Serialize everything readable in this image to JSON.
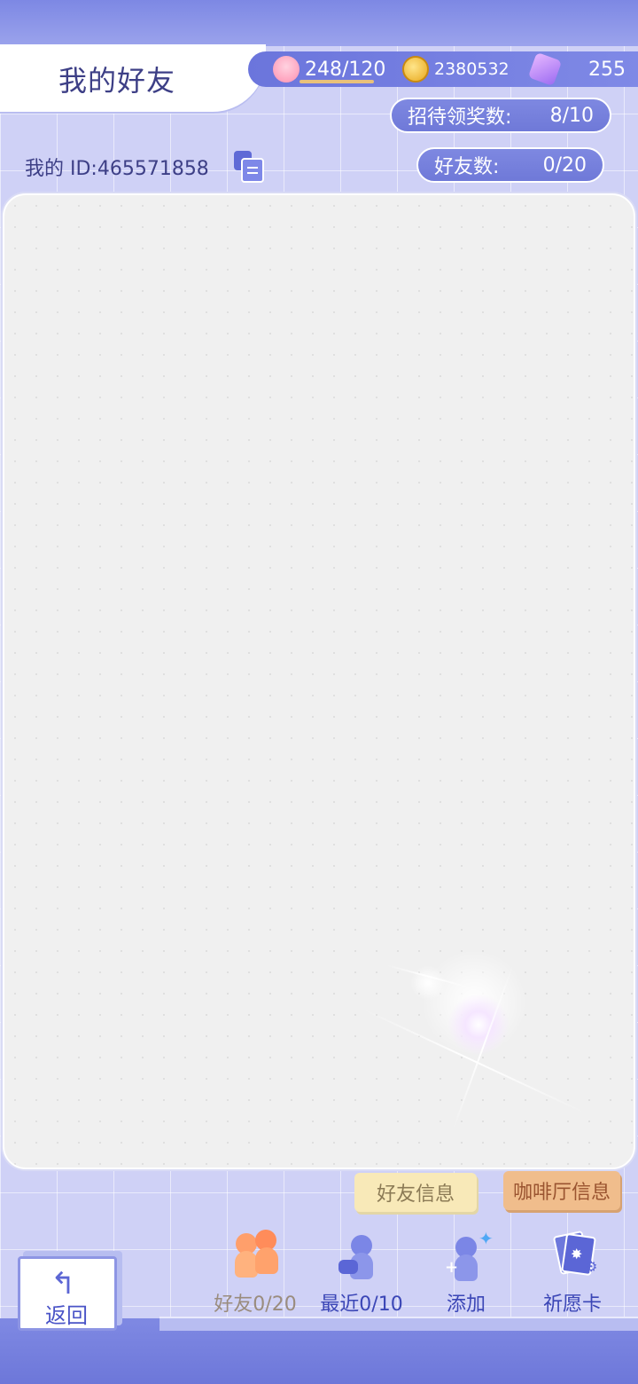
{
  "header": {
    "title": "我的好友",
    "resources": {
      "stamina": "248/120",
      "coins": "2380532",
      "gems": "255"
    }
  },
  "stats": {
    "reception_label": "招待领奖数:",
    "reception_value": "8/10",
    "friends_label": "好友数:",
    "friends_value": "0/20"
  },
  "profile": {
    "my_id": "我的 ID:465571858"
  },
  "tags": {
    "friend_info": "好友信息",
    "cafe_info": "咖啡厅信息"
  },
  "nav": {
    "back": "返回",
    "items": [
      {
        "label": "好友0/20",
        "icon": "friends-icon"
      },
      {
        "label": "最近0/10",
        "icon": "recent-icon"
      },
      {
        "label": "添加",
        "icon": "add-friend-icon"
      },
      {
        "label": "祈愿卡",
        "icon": "wish-card-icon"
      }
    ]
  },
  "colors": {
    "accent": "#6f79d8",
    "title": "#3d3f86",
    "nav_text": "#3b46b6",
    "friend_tag": "#f8e9b8",
    "cafe_tag": "#f0bd8c"
  }
}
